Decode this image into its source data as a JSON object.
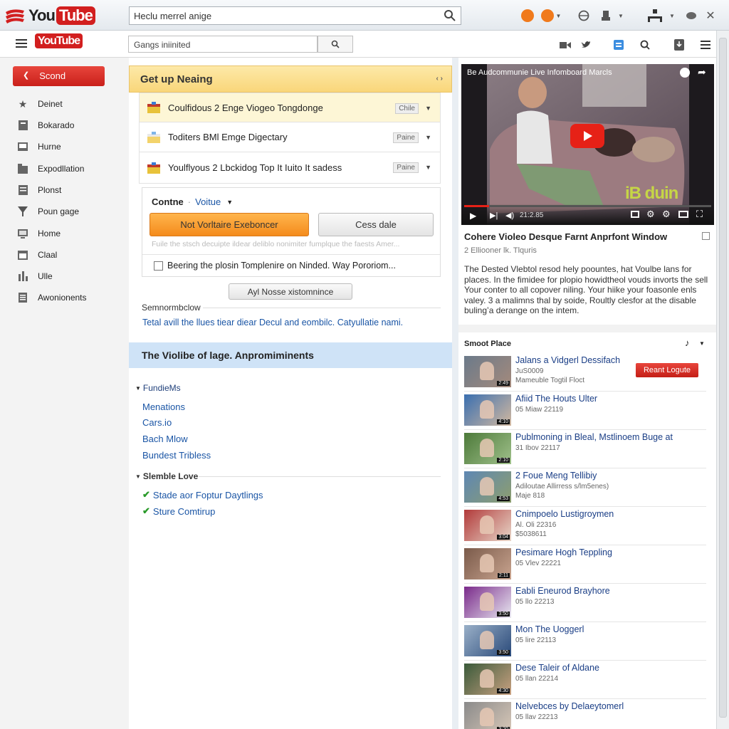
{
  "browser": {
    "address": "Heclu merrel anige"
  },
  "header": {
    "logo_you": "You",
    "logo_tube": "Tube",
    "search_value": "Gangs iniinited"
  },
  "sidebar": {
    "primary_button": "Scond",
    "items": [
      {
        "label": "Deinet",
        "icon": "star-icon"
      },
      {
        "label": "Bokarado",
        "icon": "bookmark-icon"
      },
      {
        "label": "Hurne",
        "icon": "screen-icon"
      },
      {
        "label": "Expodllation",
        "icon": "folder-icon"
      },
      {
        "label": "Plonst",
        "icon": "page-icon"
      },
      {
        "label": "Poun gage",
        "icon": "funnel-icon"
      },
      {
        "label": "Home",
        "icon": "monitor-icon"
      },
      {
        "label": "Claal",
        "icon": "window-icon"
      },
      {
        "label": "Ulle",
        "icon": "chart-icon"
      },
      {
        "label": "Awonionents",
        "icon": "list-icon"
      }
    ]
  },
  "main": {
    "banner_title": "Get up Neaing",
    "banner_arrows": "‹ ›",
    "rows": [
      {
        "title": "Coulfidous 2 Enge Viogeo Tongdonge",
        "badge": "Chile"
      },
      {
        "title": "Toditers BMl Emge Digectary",
        "badge": "Paine"
      },
      {
        "title": "Youlflyous 2 Lbckidog Top It Iuito It sadess",
        "badge": "Paine"
      }
    ],
    "panel": {
      "label": "Contne",
      "dropdown": "Voitue",
      "primary_button": "Not Vorltaire Exeboncer",
      "secondary_button": "Cess dale",
      "hint": "Fuile the stsch decuipte ildear deliblo nonimiter fumplque the faests Amer...",
      "checkbox_label": "Beering the plosin Tomplenire on Ninded. Way Pororiom..."
    },
    "center_button": "Ayl Nosse xistomnince",
    "section_label": "Semnormbclow",
    "section_link": "Tetal avill the llues tiear diear Decul and eombilc. Catyullatie nami.",
    "blue_band": "The Violibe of lage. Anpromiminents",
    "group1": {
      "title": "FundieMs",
      "links": [
        "Menations",
        "Cars.io",
        "Bach Mlow",
        "Bundest Tribless"
      ]
    },
    "group2": {
      "title": "Slemble Love",
      "links": [
        "Stade aor Foptur Daytlings",
        "Sture Comtirup"
      ]
    }
  },
  "player": {
    "overlay_title": "Be Audcommunie Live Infomboard Marcls",
    "watermark": "iB duin",
    "time": "21:2.85",
    "title": "Cohere Violeo Desque Farnt Anprfont Window",
    "subtitle": "2 Elliooner lk. Tlquris",
    "description": "The Dested Vlebtol resod hely poountes, hat Voulbe lans for places. In the fimidee for plopio howidtheol vouds invorts the sell Your conter to all copover niling. Your hiike your foasonle enls valey. 3 a malimns thal by soide, Roultly clesfor at the disable buling’a derange on the intem."
  },
  "related": {
    "header": "Smoot Place",
    "subscribe_button": "Reant Logute",
    "items": [
      {
        "title": "Jalans a Vidgerl Dessifach",
        "meta1": "JuS0009",
        "meta2": "Mameuble Togtil Floct",
        "duration": "2:49"
      },
      {
        "title": "Afiid The Houts Ulter",
        "meta1": "05 Miaw 22119",
        "meta2": "",
        "duration": "4:10"
      },
      {
        "title": "Publmoning in Bleal, Mstlinoem Buge at",
        "meta1": "31 Ibov 22117",
        "meta2": "",
        "duration": "2:10"
      },
      {
        "title": "2 Foue Meng Tellibiy",
        "meta1": "Adiloutae Allirress s/lm5enes)",
        "meta2": "Maje 818",
        "duration": "4:53"
      },
      {
        "title": "Cnimpoelo Lustigroymen",
        "meta1": "Al. Oli 22316",
        "meta2": "$5038611",
        "duration": "3:04"
      },
      {
        "title": "Pesimare Hogh Teppling",
        "meta1": "05 Vlev 22221",
        "meta2": "",
        "duration": "2:11"
      },
      {
        "title": "Eabli Eneurod Brayhore",
        "meta1": "05 llo 22213",
        "meta2": "",
        "duration": "3:50"
      },
      {
        "title": "Mon The Uoggerl",
        "meta1": "05 lire 22113",
        "meta2": "",
        "duration": "3:50"
      },
      {
        "title": "Dese Taleir of Aldane",
        "meta1": "05 llan 22214",
        "meta2": "",
        "duration": "4:30"
      },
      {
        "title": "Nelvebces by Delaeytomerl",
        "meta1": "05 llav 22213",
        "meta2": "",
        "duration": "3:20"
      }
    ]
  },
  "colors": {
    "brand_red": "#d21f1f",
    "banner_yellow": "#f9d67a",
    "primary_orange": "#f48b1c",
    "link_blue": "#1a55a5",
    "band_blue": "#cfe3f7",
    "check_green": "#2a9a2a"
  }
}
